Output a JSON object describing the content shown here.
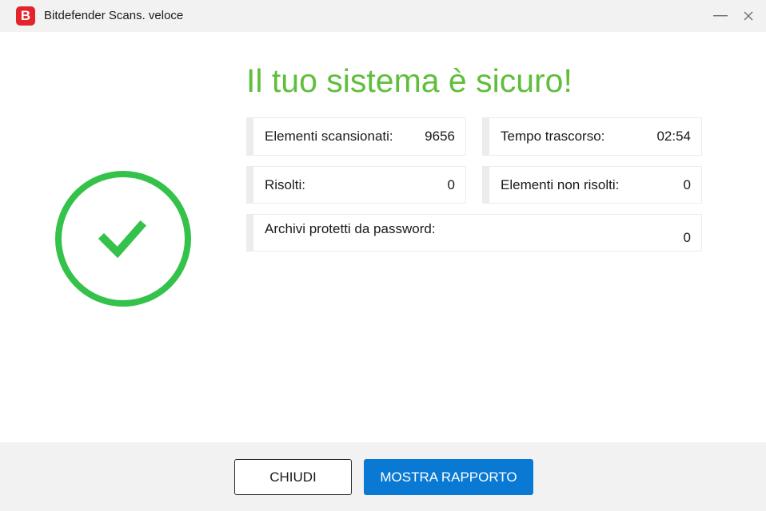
{
  "window": {
    "title": "Bitdefender Scans. veloce",
    "logo_letter": "B",
    "brand_color": "#e3242b"
  },
  "status": {
    "icon": "check-circle-icon",
    "color": "#34c24a",
    "headline": "Il tuo sistema è sicuro!",
    "headline_color": "#5fbe3c"
  },
  "stats": {
    "scanned": {
      "label": "Elementi scansionati:",
      "value": "9656"
    },
    "elapsed": {
      "label": "Tempo trascorso:",
      "value": "02:54"
    },
    "resolved": {
      "label": "Risolti:",
      "value": "0"
    },
    "unresolved": {
      "label": "Elementi non risolti:",
      "value": "0"
    },
    "password_archives": {
      "label": "Archivi protetti da password:",
      "value": "0"
    }
  },
  "footer": {
    "close_label": "CHIUDI",
    "report_label": "MOSTRA RAPPORTO",
    "accent": "#0a79d4"
  }
}
